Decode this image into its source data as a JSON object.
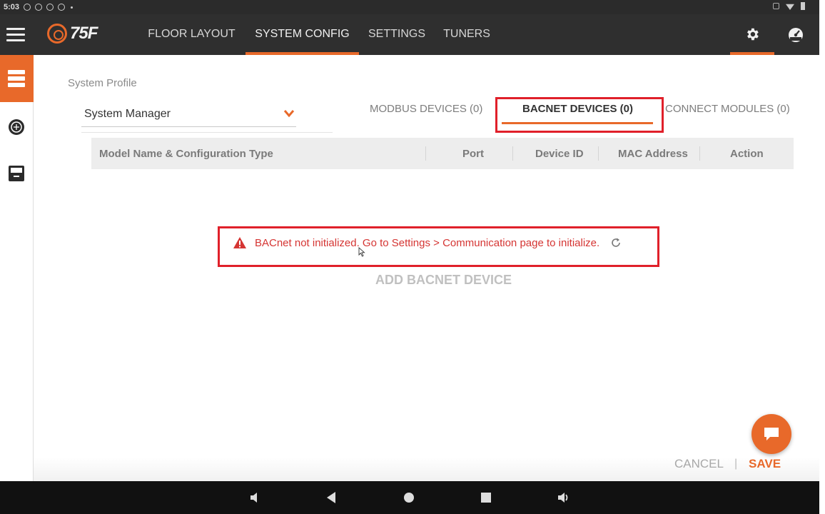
{
  "status_bar": {
    "time": "5:03"
  },
  "app_bar": {
    "logo_text": "75F",
    "tabs": [
      {
        "label": "FLOOR LAYOUT"
      },
      {
        "label": "SYSTEM CONFIG",
        "active": true
      },
      {
        "label": "SETTINGS"
      },
      {
        "label": "TUNERS"
      }
    ],
    "icons": [
      "hamburger-icon",
      "gear-icon",
      "dashboard-icon"
    ]
  },
  "sidebar": {
    "items": [
      {
        "icon": "server-icon",
        "active": true
      },
      {
        "icon": "thermostat-icon"
      },
      {
        "icon": "device-icon"
      }
    ]
  },
  "profile": {
    "label": "System Profile",
    "selected": "System Manager"
  },
  "sub_tabs": [
    {
      "label": "MODBUS DEVICES (0)"
    },
    {
      "label": "BACNET DEVICES (0)",
      "active": true
    },
    {
      "label": "CONNECT MODULES (0)"
    }
  ],
  "table": {
    "columns": [
      "Model Name & Configuration Type",
      "Port",
      "Device ID",
      "MAC Address",
      "Action"
    ],
    "rows": []
  },
  "message": {
    "text": "BACnet not initialized. Go to Settings > Communication page to initialize."
  },
  "actions": {
    "add_device": "ADD BACNET DEVICE",
    "cancel": "CANCEL",
    "separator": "|",
    "save": "SAVE"
  },
  "colors": {
    "accent": "#e8692a",
    "app_bar": "#2f2f2f",
    "error": "#d53533",
    "highlight": "#e0202a"
  }
}
